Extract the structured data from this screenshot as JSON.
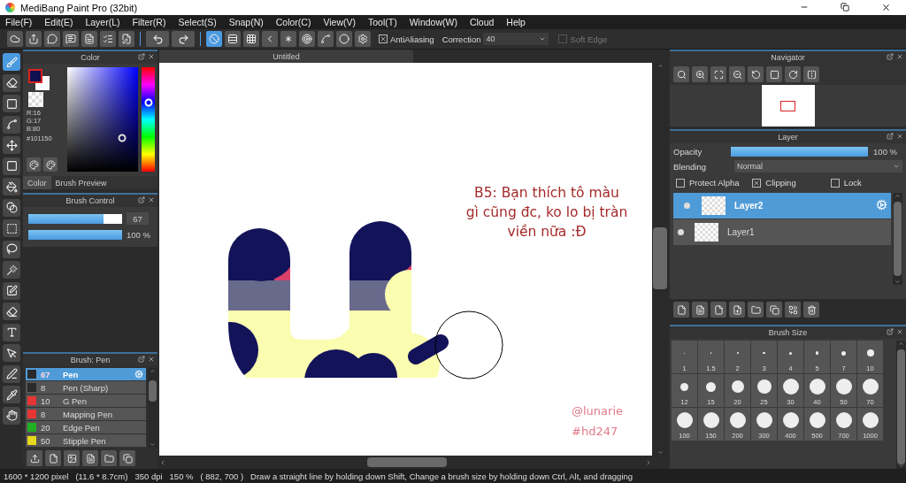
{
  "window": {
    "title": "MediBang Paint Pro (32bit)"
  },
  "menu": [
    "File(F)",
    "Edit(E)",
    "Layer(L)",
    "Filter(R)",
    "Select(S)",
    "Snap(N)",
    "Color(C)",
    "View(V)",
    "Tool(T)",
    "Window(W)",
    "Cloud",
    "Help"
  ],
  "toolbar": {
    "snaps": [
      {
        "kind": "off",
        "selected": true
      },
      {
        "kind": "parallel",
        "selected": false
      },
      {
        "kind": "grid",
        "selected": false
      },
      {
        "kind": "perspective",
        "selected": false
      },
      {
        "kind": "radial",
        "selected": false
      },
      {
        "kind": "concentric",
        "selected": false
      },
      {
        "kind": "curve",
        "selected": false
      },
      {
        "kind": "circle",
        "selected": false
      },
      {
        "kind": "settings",
        "selected": false
      }
    ],
    "antialiasing": {
      "label": "AntiAliasing",
      "checked": true
    },
    "correction": {
      "label": "Correction",
      "value": "40"
    },
    "soft_edge": {
      "label": "Soft Edge",
      "checked": false
    }
  },
  "tools": [
    {
      "kind": "brush",
      "selected": true
    },
    {
      "kind": "eraser",
      "selected": false
    },
    {
      "kind": "shape",
      "selected": false
    },
    {
      "kind": "dotline",
      "selected": false
    },
    {
      "kind": "move",
      "selected": false
    },
    {
      "kind": "fill",
      "selected": false
    },
    {
      "kind": "bucket",
      "selected": false
    },
    {
      "kind": "gradient",
      "selected": false
    },
    {
      "kind": "select",
      "selected": false
    },
    {
      "kind": "lasso",
      "selected": false
    },
    {
      "kind": "wand",
      "selected": false
    },
    {
      "kind": "selectpen",
      "selected": false
    },
    {
      "kind": "selecteraser",
      "selected": false
    },
    {
      "kind": "text",
      "selected": false
    },
    {
      "kind": "divide",
      "selected": false
    },
    {
      "kind": "pen",
      "selected": false
    },
    {
      "kind": "eyedropper",
      "selected": false
    },
    {
      "kind": "hand",
      "selected": false
    }
  ],
  "color_panel": {
    "title": "Color",
    "rgb": [
      "R:16",
      "G:17",
      "B:80"
    ],
    "hex": "#101150",
    "tabs": [
      {
        "label": "Color",
        "selected": true
      },
      {
        "label": "Brush Preview",
        "selected": false
      }
    ]
  },
  "brush_control": {
    "title": "Brush Control",
    "size": {
      "level": 0.8,
      "reading": "67"
    },
    "opacity": {
      "level": 1,
      "reading": "100 %"
    }
  },
  "brush_list": {
    "title": "Brush: Pen",
    "items": [
      {
        "size": "67",
        "name": "Pen",
        "color": "#2a2a2a",
        "selected": true
      },
      {
        "size": "8",
        "name": "Pen (Sharp)",
        "color": "#2a2a2a",
        "selected": false
      },
      {
        "size": "10",
        "name": "G Pen",
        "color": "#e53535",
        "selected": false
      },
      {
        "size": "8",
        "name": "Mapping Pen",
        "color": "#e53535",
        "selected": false
      },
      {
        "size": "20",
        "name": "Edge Pen",
        "color": "#22b022",
        "selected": false
      },
      {
        "size": "50",
        "name": "Stipple Pen",
        "color": "#e8d81c",
        "selected": false
      }
    ]
  },
  "canvas": {
    "tab": "Untitled",
    "caption": [
      "B5: Bạn thích tô màu",
      "gì cũng đc, ko lo bị tràn",
      "viền nữa :Đ"
    ],
    "signature": [
      "@lunarie",
      "#hd247"
    ]
  },
  "navigator": {
    "title": "Navigator"
  },
  "layer_panel": {
    "title": "Layer",
    "opacity": {
      "label": "Opacity",
      "level": 1,
      "reading": "100 %"
    },
    "blending": {
      "label": "Blending",
      "value": "Normal"
    },
    "options": [
      {
        "label": "Protect Alpha",
        "checked": false
      },
      {
        "label": "Clipping",
        "checked": true
      },
      {
        "label": "Lock",
        "checked": false
      }
    ],
    "layers": [
      {
        "name": "Layer2",
        "selected": true
      },
      {
        "name": "Layer1",
        "selected": false
      }
    ]
  },
  "brush_size": {
    "title": "Brush Size",
    "sizes": [
      "1",
      "1.5",
      "2",
      "3",
      "4",
      "5",
      "7",
      "10",
      "12",
      "15",
      "20",
      "25",
      "30",
      "40",
      "50",
      "70",
      "100",
      "150",
      "200",
      "300",
      "400",
      "500",
      "700",
      "1000"
    ]
  },
  "status_bar": [
    "1600 * 1200 pixel",
    "(11.6 * 8.7cm)",
    "350 dpi",
    "150 %",
    "( 882, 700 )",
    "Draw a straight line by holding down Shift, Change a brush size by holding down Ctrl, Alt, and dragging"
  ]
}
